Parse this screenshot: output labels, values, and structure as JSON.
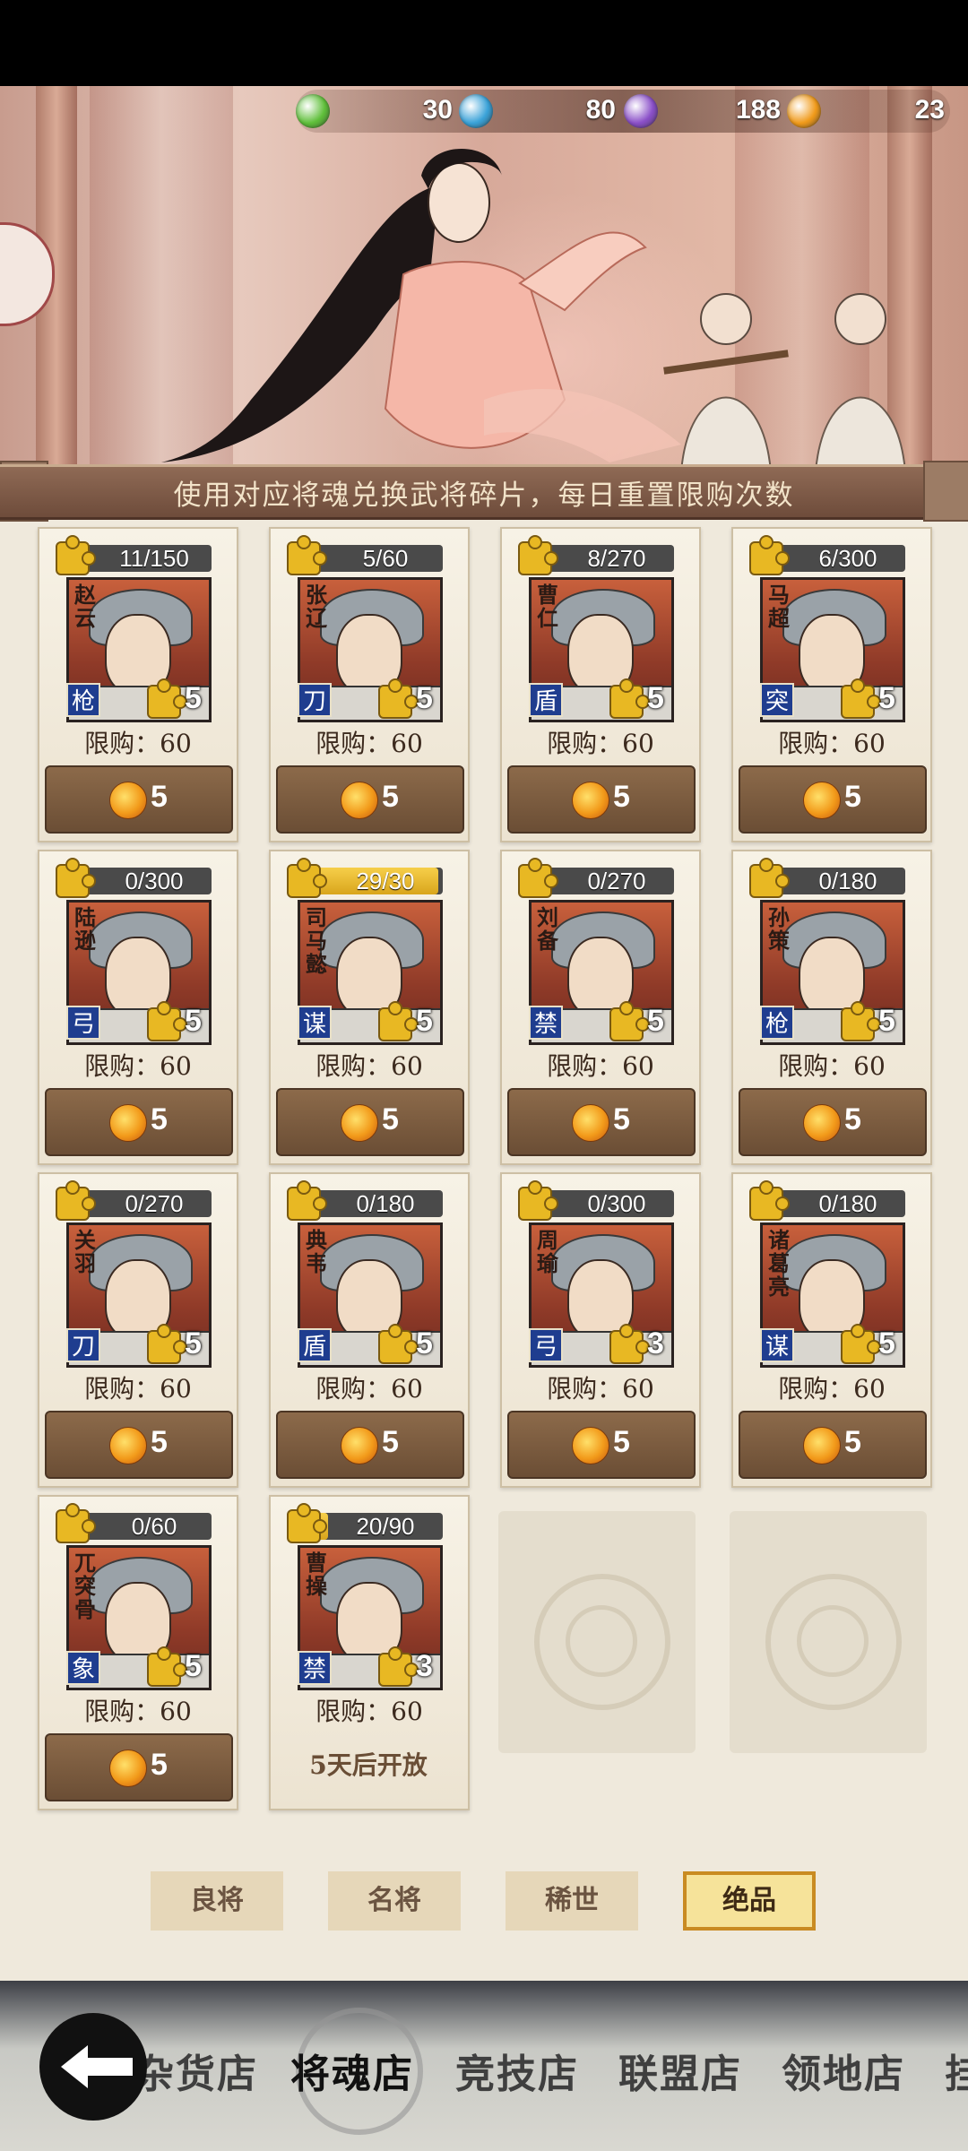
{
  "currencies": [
    {
      "icon": "green-jade-icon",
      "value": "30",
      "color": "#5fbf3a"
    },
    {
      "icon": "blue-jade-icon",
      "value": "80",
      "color": "#3aa2d8"
    },
    {
      "icon": "purple-jade-icon",
      "value": "188",
      "color": "#8a4fc8"
    },
    {
      "icon": "orange-jade-icon",
      "value": "23",
      "color": "#f09a1a"
    }
  ],
  "notice": "使用对应将魂兑换武将碎片，每日重置限购次数",
  "cards": [
    {
      "name": "赵云",
      "fragments": "11/150",
      "fill": 0.073,
      "type": "枪",
      "stars": "5",
      "limit": "限购：60",
      "price": "5"
    },
    {
      "name": "张辽",
      "fragments": "5/60",
      "fill": 0.083,
      "type": "刀",
      "stars": "5",
      "limit": "限购：60",
      "price": "5"
    },
    {
      "name": "曹仁",
      "fragments": "8/270",
      "fill": 0.03,
      "type": "盾",
      "stars": "5",
      "limit": "限购：60",
      "price": "5"
    },
    {
      "name": "马超",
      "fragments": "6/300",
      "fill": 0.02,
      "type": "突",
      "stars": "5",
      "limit": "限购：60",
      "price": "5"
    },
    {
      "name": "陆逊",
      "fragments": "0/300",
      "fill": 0,
      "type": "弓",
      "stars": "5",
      "limit": "限购：60",
      "price": "5"
    },
    {
      "name": "司马懿",
      "fragments": "29/30",
      "fill": 0.967,
      "type": "谋",
      "stars": "5",
      "limit": "限购：60",
      "price": "5"
    },
    {
      "name": "刘备",
      "fragments": "0/270",
      "fill": 0,
      "type": "禁",
      "stars": "5",
      "limit": "限购：60",
      "price": "5"
    },
    {
      "name": "孙策",
      "fragments": "0/180",
      "fill": 0,
      "type": "枪",
      "stars": "5",
      "limit": "限购：60",
      "price": "5"
    },
    {
      "name": "关羽",
      "fragments": "0/270",
      "fill": 0,
      "type": "刀",
      "stars": "5",
      "limit": "限购：60",
      "price": "5"
    },
    {
      "name": "典韦",
      "fragments": "0/180",
      "fill": 0,
      "type": "盾",
      "stars": "5",
      "limit": "限购：60",
      "price": "5"
    },
    {
      "name": "周瑜",
      "fragments": "0/300",
      "fill": 0,
      "type": "弓",
      "stars": "3",
      "limit": "限购：60",
      "price": "5"
    },
    {
      "name": "诸葛亮",
      "fragments": "0/180",
      "fill": 0,
      "type": "谋",
      "stars": "5",
      "limit": "限购：60",
      "price": "5"
    },
    {
      "name": "兀突骨",
      "fragments": "0/60",
      "fill": 0,
      "type": "象",
      "stars": "5",
      "limit": "限购：60",
      "price": "5"
    },
    {
      "name": "曹操",
      "fragments": "20/90",
      "fill": 0.222,
      "type": "禁",
      "stars": "3",
      "limit": "限购：60",
      "locked_text": "5天后开放"
    }
  ],
  "tiers": [
    "良将",
    "名将",
    "稀世",
    "绝品"
  ],
  "active_tier": "绝品",
  "nav": [
    "杂货店",
    "将魂店",
    "竞技店",
    "联盟店",
    "领地店",
    "挂"
  ],
  "nav_active": "将魂店",
  "colors": {
    "type_tag": "#1f3d8f",
    "button": "#6b4e35",
    "fragment_fill": "#e8b823"
  }
}
